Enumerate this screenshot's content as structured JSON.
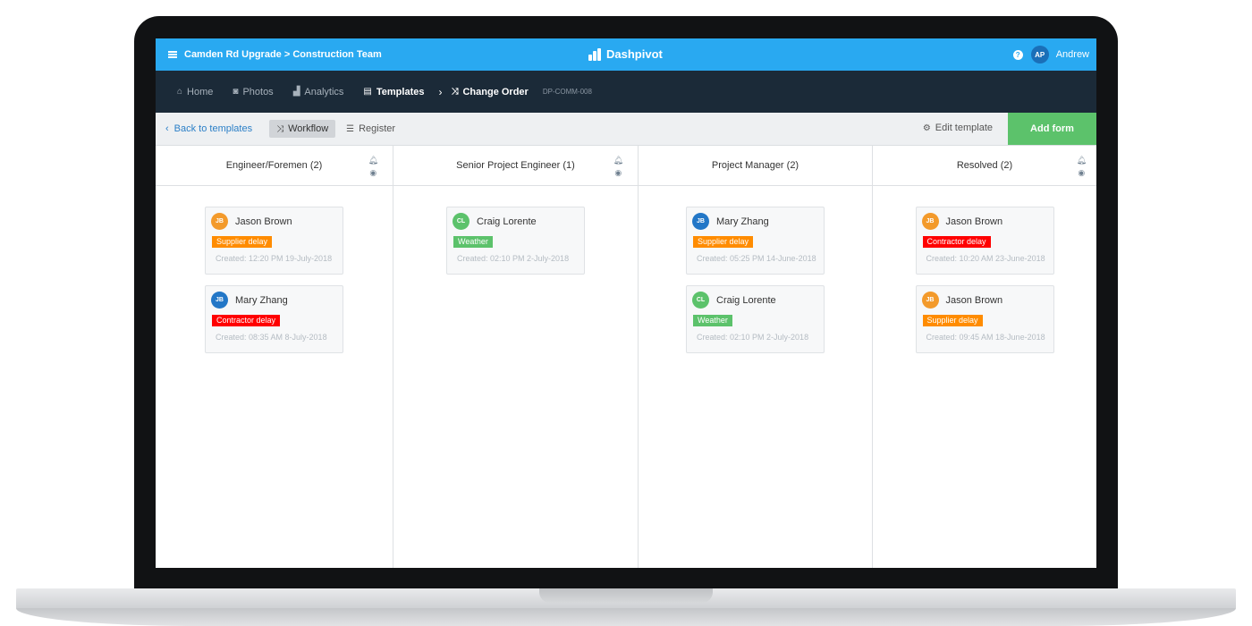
{
  "topbar": {
    "breadcrumb": "Camden Rd Upgrade > Construction Team",
    "brand": "Dashpivot",
    "help": "?",
    "user_initials": "AP",
    "user_name": "Andrew"
  },
  "nav": {
    "home": "Home",
    "photos": "Photos",
    "analytics": "Analytics",
    "templates": "Templates",
    "change_order": "Change Order",
    "code": "DP-COMM-008"
  },
  "toolbar": {
    "back": "Back to templates",
    "workflow": "Workflow",
    "register": "Register",
    "edit_template": "Edit template",
    "add_form": "Add form"
  },
  "colors": {
    "orange": "#ff8c00",
    "red": "#ff0000",
    "green": "#5cc26b",
    "avatar_orange": "#f39a2b",
    "avatar_blue": "#2377c7",
    "avatar_green": "#5cc26b"
  },
  "columns": [
    {
      "title": "Engineer/Foremen (2)",
      "cards": [
        {
          "initials": "JB",
          "name": "Jason Brown",
          "tag": "Supplier delay",
          "tag_color": "#ff8c00",
          "avatar_color": "#f39a2b",
          "created": "Created: 12:20 PM 19-July-2018"
        },
        {
          "initials": "JB",
          "name": "Mary Zhang",
          "tag": "Contractor delay",
          "tag_color": "#ff0000",
          "avatar_color": "#2377c7",
          "created": "Created: 08:35 AM 8-July-2018"
        }
      ]
    },
    {
      "title": "Senior Project Engineer (1)",
      "cards": [
        {
          "initials": "CL",
          "name": "Craig Lorente",
          "tag": "Weather",
          "tag_color": "#5cc26b",
          "avatar_color": "#5cc26b",
          "created": "Created: 02:10 PM 2-July-2018"
        }
      ]
    },
    {
      "title": "Project Manager (2)",
      "cards": [
        {
          "initials": "JB",
          "name": "Mary Zhang",
          "tag": "Supplier delay",
          "tag_color": "#ff8c00",
          "avatar_color": "#2377c7",
          "created": "Created: 05:25 PM 14-June-2018"
        },
        {
          "initials": "CL",
          "name": "Craig Lorente",
          "tag": "Weather",
          "tag_color": "#5cc26b",
          "avatar_color": "#5cc26b",
          "created": "Created: 02:10 PM 2-July-2018"
        }
      ]
    },
    {
      "title": "Resolved (2)",
      "cards": [
        {
          "initials": "JB",
          "name": "Jason Brown",
          "tag": "Contractor delay",
          "tag_color": "#ff0000",
          "avatar_color": "#f39a2b",
          "created": "Created: 10:20 AM 23-June-2018"
        },
        {
          "initials": "JB",
          "name": "Jason Brown",
          "tag": "Supplier delay",
          "tag_color": "#ff8c00",
          "avatar_color": "#f39a2b",
          "created": "Created: 09:45 AM 18-June-2018"
        }
      ]
    }
  ]
}
